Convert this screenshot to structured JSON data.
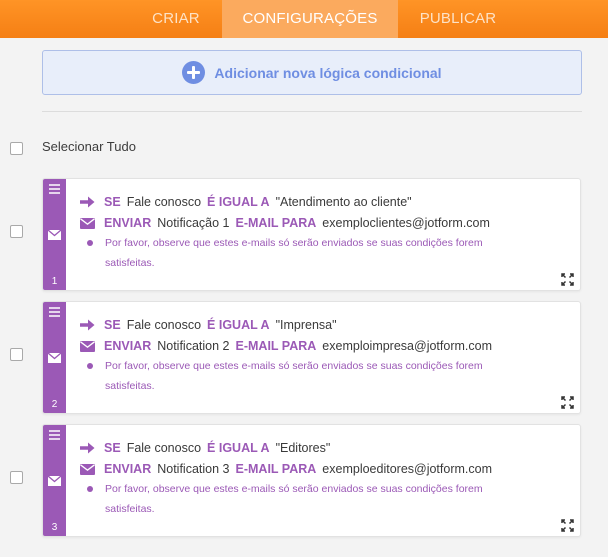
{
  "tabs": [
    "CRIAR",
    "CONFIGURAÇÕES",
    "PUBLICAR"
  ],
  "add_condition_label": "Adicionar nova lógica condicional",
  "select_all_label": "Selecionar Tudo",
  "icons": {
    "add": "plus-circle-icon",
    "condition": "arrow-right-icon",
    "action": "envelope-icon",
    "card_side": "envelope-icon",
    "drag": "drag-handle-icon",
    "expand": "expand-icon"
  },
  "colors": {
    "topbar": "#f58a1c",
    "active_tab": "#fbaa5e",
    "accent_purple": "#9b59b6",
    "add_button_text": "#6f8ee2"
  },
  "rules": [
    {
      "number": "1",
      "if_kw": "SE",
      "field": "Fale conosco",
      "op_kw": "É IGUAL A",
      "value": "\"Atendimento ao cliente\"",
      "action_kw": "ENVIAR",
      "notification": "Notificação 1",
      "to_kw": "E-MAIL PARA",
      "email": "exemploclientes@jotform.com",
      "note_line1": "Por favor, observe que estes e-mails só serão enviados se suas condições forem",
      "note_line2": "satisfeitas."
    },
    {
      "number": "2",
      "if_kw": "SE",
      "field": "Fale conosco",
      "op_kw": "É IGUAL A",
      "value": "\"Imprensa\"",
      "action_kw": "ENVIAR",
      "notification": "Notification 2",
      "to_kw": "E-MAIL PARA",
      "email": "exemploimpresa@jotform.com",
      "note_line1": "Por favor, observe que estes e-mails só serão enviados se suas condições forem",
      "note_line2": "satisfeitas."
    },
    {
      "number": "3",
      "if_kw": "SE",
      "field": "Fale conosco",
      "op_kw": "É IGUAL A",
      "value": "\"Editores\"",
      "action_kw": "ENVIAR",
      "notification": "Notification 3",
      "to_kw": "E-MAIL PARA",
      "email": "exemploeditores@jotform.com",
      "note_line1": "Por favor, observe que estes e-mails só serão enviados se suas condições forem",
      "note_line2": "satisfeitas."
    }
  ]
}
